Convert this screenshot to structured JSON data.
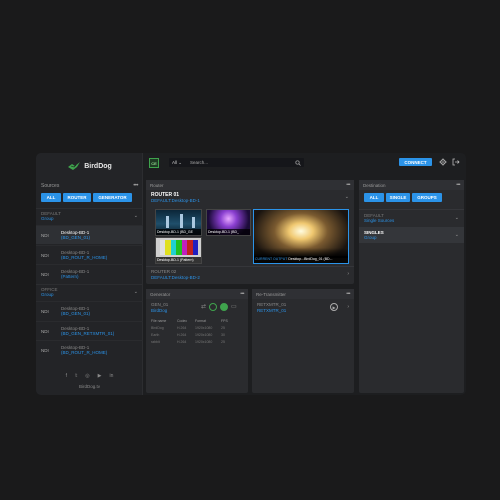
{
  "brand": {
    "name": "BirdDog",
    "site": "BirdDog.tv"
  },
  "topbar": {
    "badge": "CE",
    "filter_value": "All",
    "search_placeholder": "Search...",
    "connect_label": "CONNECT"
  },
  "sources": {
    "title": "Sources",
    "menu": "•••",
    "tabs": [
      "ALL",
      "ROUTER",
      "GENERATOR"
    ],
    "groups": [
      {
        "name": "DEFAULT",
        "sub": "Group",
        "items": [
          {
            "ndi": "NDI",
            "name": "Desktop-BD-1",
            "sub": "(BD_GEN_01)"
          },
          {
            "ndi": "NDI",
            "name": "Desktop-BD-1",
            "sub": "(BD_ROUT_R_HOME)"
          },
          {
            "ndi": "NDI",
            "name": "Desktop-BD-1",
            "sub": "(Pattern)"
          }
        ]
      },
      {
        "name": "OFFICE",
        "sub": "Group",
        "items": [
          {
            "ndi": "NDI",
            "name": "Desktop-BD-1",
            "sub": "(BD_GEN_01)"
          },
          {
            "ndi": "NDI",
            "name": "Desktop-BD-1",
            "sub": "(BD_GEN_RETXMTR_01)"
          },
          {
            "ndi": "NDI",
            "name": "Desktop-BD-1",
            "sub": "(BD_ROUT_R_HOME)"
          }
        ]
      }
    ]
  },
  "social_icons": [
    "facebook-icon",
    "twitter-icon",
    "instagram-icon",
    "youtube-icon",
    "linkedin-icon"
  ],
  "router": {
    "title": "Router",
    "menu": "•••",
    "name": "ROUTER 01",
    "source": "DEFAULT:Desktop-BD-1",
    "thumbs": [
      {
        "label": "Desktop-BD-1 (BD_GE"
      },
      {
        "label": "Desktop-BD-1 (BD_"
      },
      {
        "label": "Desktop-BD-1 (Pattern)"
      }
    ],
    "big_thumb": {
      "label_left": "CURRENT OUTPUT",
      "label_right": "Desktop...BirdDog_01 (BD..."
    },
    "router02_name": "ROUTER 02",
    "router02_source": "DEFAULT:Desktop-BD-2"
  },
  "generator": {
    "title": "Generator",
    "menu": "•••",
    "name": "GEN_01",
    "sub": "BirdDog",
    "table": {
      "headers": [
        "File name",
        "Codec",
        "Format",
        "FPS"
      ],
      "rows": [
        [
          "BirdDog",
          "H.264",
          "1920x1080",
          "25"
        ],
        [
          "Earth",
          "H.264",
          "1920x1080",
          "30"
        ],
        [
          "rabbit",
          "H.264",
          "1920x1080",
          "25"
        ]
      ]
    }
  },
  "retransmitter": {
    "title": "Re-Transmitter",
    "menu": "•••",
    "name": "RETXMTR_01",
    "sub": "RETXMTR_01"
  },
  "destination": {
    "title": "Destination",
    "menu": "•••",
    "tabs": [
      "ALL",
      "SINGLE",
      "GROUPS"
    ],
    "items": [
      {
        "name": "DEFAULT",
        "sub": "Single Sources"
      },
      {
        "name": "SINGLES",
        "sub": "Group"
      }
    ]
  },
  "colors": {
    "accent": "#2b93e8",
    "bg": "#1a1a1b",
    "panel": "#2a2b2e",
    "logo_green": "#3fa34d"
  }
}
